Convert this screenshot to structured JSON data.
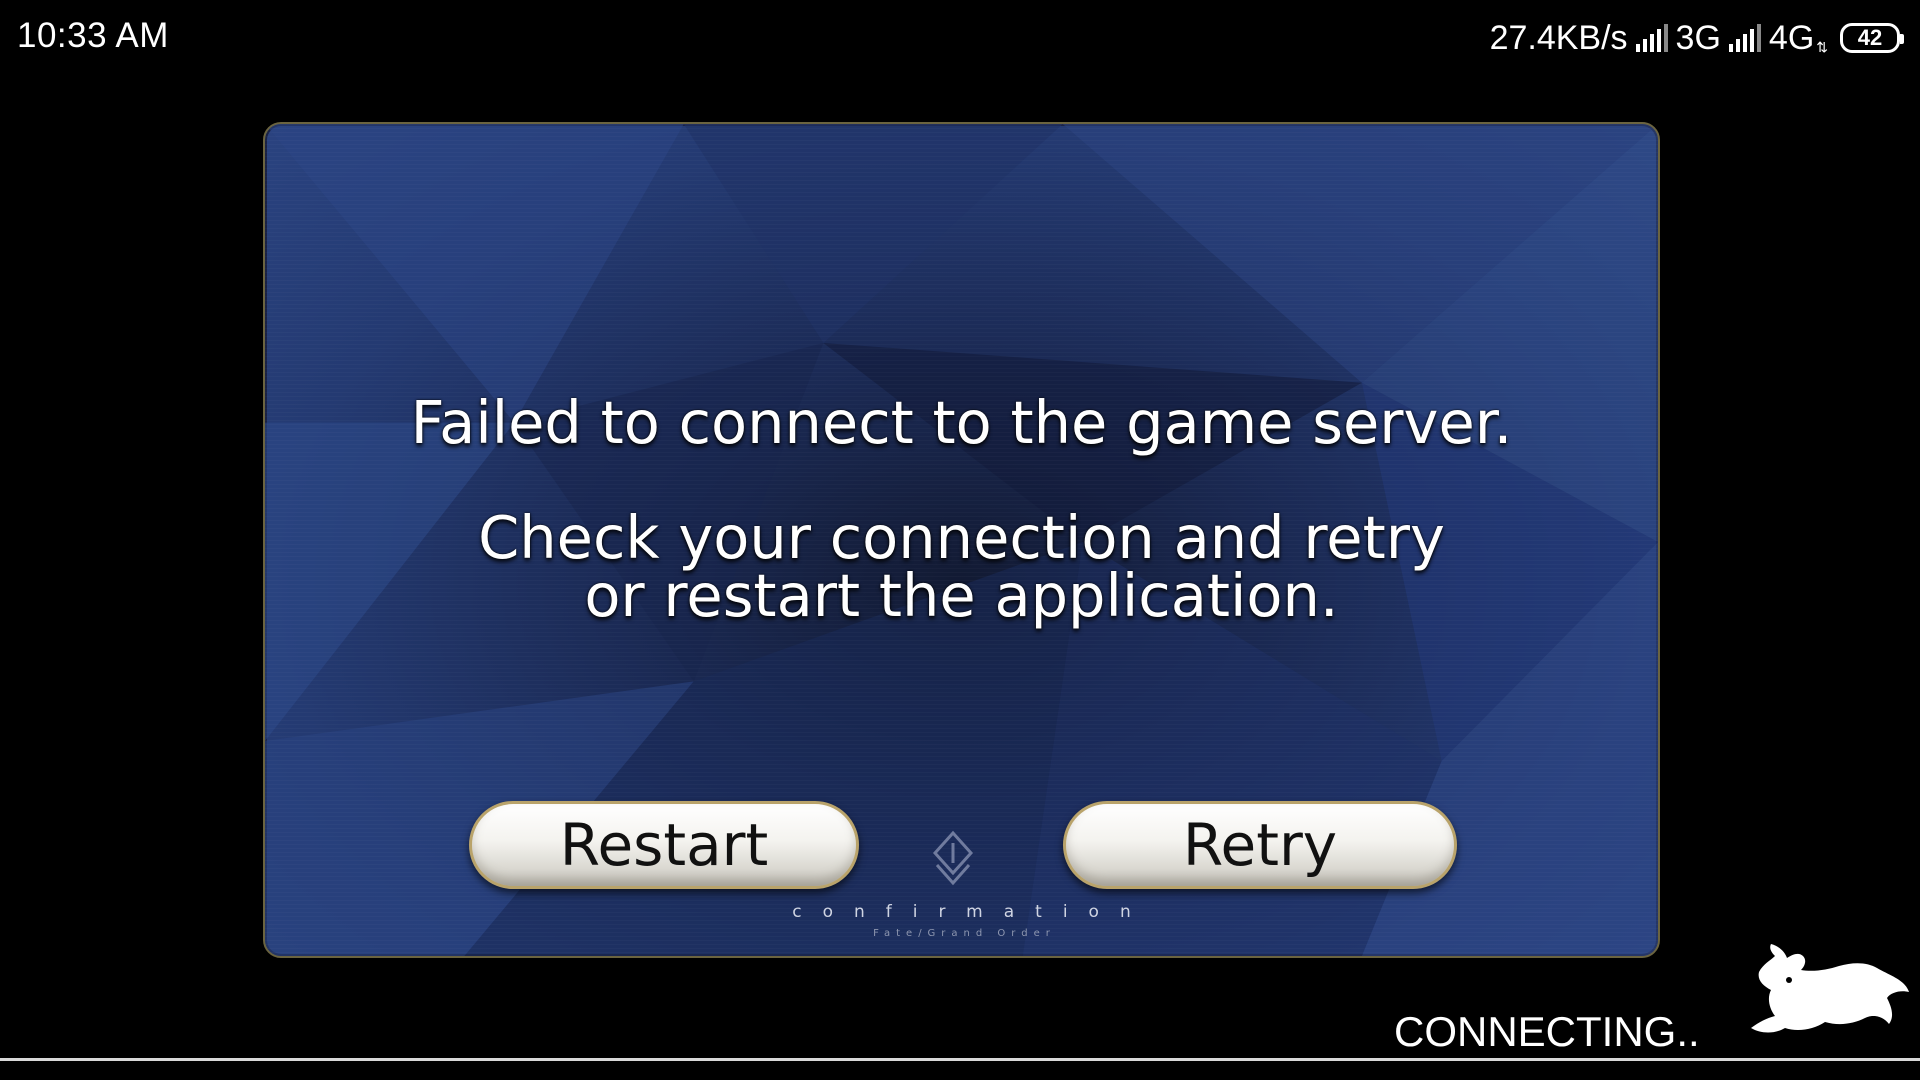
{
  "status_bar": {
    "time": "10:33  AM",
    "net_speed": "27.4KB/s",
    "network_1": "3G",
    "network_2": "4G",
    "battery": "42"
  },
  "dialog": {
    "message_line1": "Failed to connect to the game server.",
    "message_line2": "Check your connection and retry",
    "message_line3": "or restart the application.",
    "restart_label": "Restart",
    "retry_label": "Retry",
    "confirmation_label": "confirmation",
    "game_label": "Fate/Grand Order"
  },
  "loading": {
    "status_text": "CONNECTING.."
  },
  "colors": {
    "dialog_bg": "#243a72",
    "dialog_border": "#6b6440",
    "button_border": "#b9a36a"
  },
  "icons": [
    "signal-icon",
    "battery-icon",
    "fgo-emblem-icon",
    "fou-silhouette-icon"
  ]
}
